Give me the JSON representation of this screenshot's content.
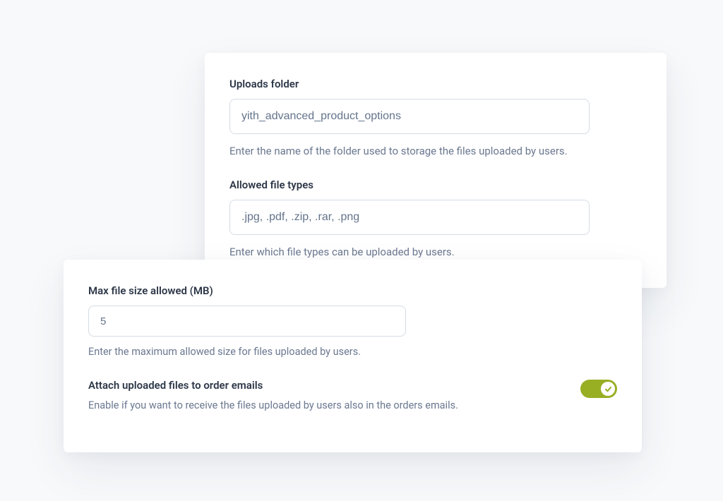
{
  "uploads_folder": {
    "label": "Uploads folder",
    "value": "yith_advanced_product_options",
    "help": "Enter the name of the folder used to storage the files uploaded by users."
  },
  "allowed_types": {
    "label": "Allowed file types",
    "value": ".jpg, .pdf, .zip, .rar, .png",
    "help": "Enter which file types can be uploaded by users."
  },
  "max_size": {
    "label": "Max file size allowed (MB)",
    "value": "5",
    "help": "Enter the maximum allowed size for files uploaded by users."
  },
  "attach_emails": {
    "label": "Attach uploaded files to order emails",
    "help": "Enable if you want to receive the files uploaded by users also in the orders emails.",
    "enabled": true
  },
  "colors": {
    "toggle_on": "#98af24"
  }
}
